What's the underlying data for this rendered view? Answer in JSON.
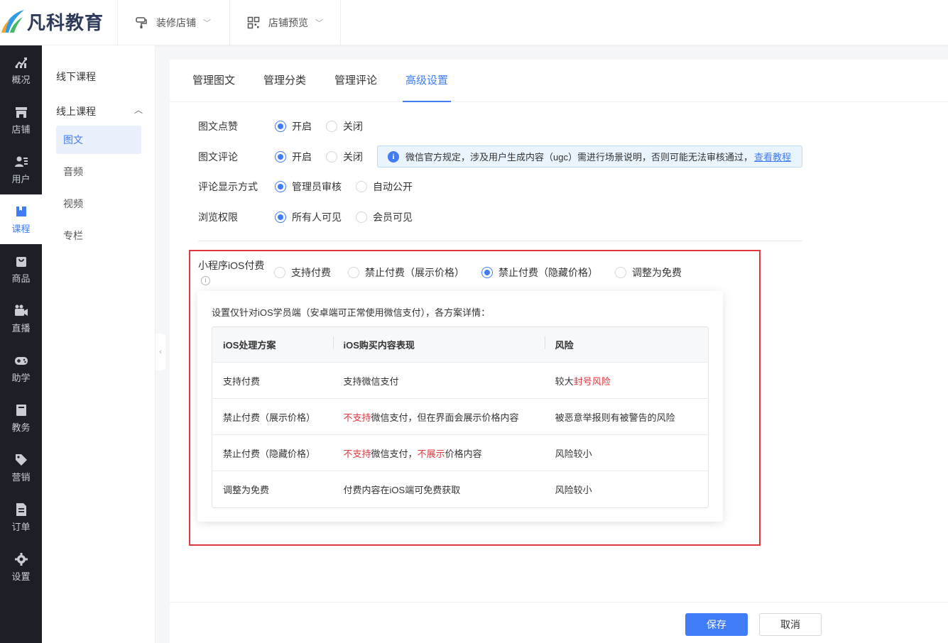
{
  "brand": {
    "name": "凡科教育"
  },
  "topbar": {
    "items": [
      {
        "label": "装修店铺",
        "icon": "paint-roller-icon"
      },
      {
        "label": "店铺预览",
        "icon": "qrcode-icon"
      }
    ]
  },
  "leftnav": {
    "items": [
      {
        "label": "概况",
        "icon": "chart-icon"
      },
      {
        "label": "店铺",
        "icon": "store-icon"
      },
      {
        "label": "用户",
        "icon": "users-icon"
      },
      {
        "label": "课程",
        "icon": "book-icon",
        "active": true
      },
      {
        "label": "商品",
        "icon": "bag-icon"
      },
      {
        "label": "直播",
        "icon": "video-camera-icon"
      },
      {
        "label": "助学",
        "icon": "gamepad-icon"
      },
      {
        "label": "教务",
        "icon": "notebook-icon"
      },
      {
        "label": "营销",
        "icon": "tag-icon"
      },
      {
        "label": "订单",
        "icon": "document-icon"
      },
      {
        "label": "设置",
        "icon": "gear-icon"
      }
    ]
  },
  "submenu": {
    "offline": "线下课程",
    "online": "线上课程",
    "items": [
      "图文",
      "音频",
      "视频",
      "专栏"
    ]
  },
  "tabs": [
    "管理图文",
    "管理分类",
    "管理评论",
    "高级设置"
  ],
  "form": {
    "like": {
      "label": "图文点赞",
      "options": [
        "开启",
        "关闭"
      ]
    },
    "comment": {
      "label": "图文评论",
      "options": [
        "开启",
        "关闭"
      ]
    },
    "display": {
      "label": "评论显示方式",
      "options": [
        "管理员审核",
        "自动公开"
      ]
    },
    "browse": {
      "label": "浏览权限",
      "options": [
        "所有人可见",
        "会员可见"
      ]
    },
    "ios": {
      "label": "小程序iOS付费",
      "options": [
        "支持付费",
        "禁止付费（展示价格）",
        "禁止付费（隐藏价格）",
        "调整为免费"
      ]
    }
  },
  "notice": {
    "text": "微信官方规定，涉及用户生成内容（ugc）需进行场景说明，否则可能无法审核通过，",
    "link": "查看教程"
  },
  "popover": {
    "desc": "设置仅针对iOS学员端（安卓端可正常使用微信支付），各方案详情：",
    "headers": [
      "iOS处理方案",
      "iOS购买内容表现",
      "风险"
    ],
    "rows": [
      {
        "plan": "支持付费",
        "behavior": "支持微信支付",
        "risk_prefix": "较大",
        "risk_red": "封号风险"
      },
      {
        "plan": "禁止付费（展示价格）",
        "behavior_red": "不支持",
        "behavior": "微信支付，但在界面会展示价格内容",
        "risk": "被恶意举报则有被警告的风险"
      },
      {
        "plan": "禁止付费（隐藏价格）",
        "behavior_red": "不支持",
        "behavior_mid": "微信支付，",
        "behavior_red2": "不展示",
        "behavior_end": "价格内容",
        "risk": "风险较小"
      },
      {
        "plan": "调整为免费",
        "behavior": "付费内容在iOS端可免费获取",
        "risk": "风险较小"
      }
    ]
  },
  "footer": {
    "save": "保存",
    "cancel": "取消"
  },
  "colors": {
    "accent": "#3f7cf5",
    "danger": "#e0383e",
    "nav_bg": "#1c1f26"
  }
}
